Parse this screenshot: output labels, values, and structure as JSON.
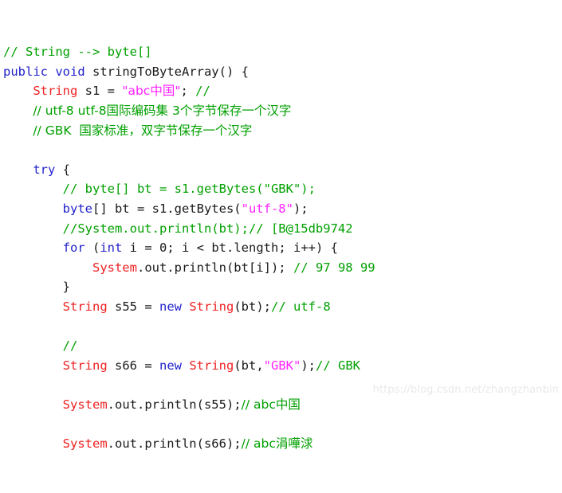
{
  "document": {
    "type": "source-code-screenshot",
    "language": "Java",
    "title": "stringToByteArray code snippet",
    "watermark": "https://blog.csdn.net/zhangzhanbin",
    "colors": {
      "background": "#ffffff",
      "comment": "#00a000",
      "keyword": "#2222cc",
      "class_name": "#ee2222",
      "string_literal": "#ff22ff",
      "plain_text": "#1a1a1a",
      "watermark": "#e9e9e9"
    }
  },
  "code": {
    "lines": [
      {
        "index": 1,
        "text": "// String --> byte[]",
        "tokens": [
          {
            "t": "// String --> byte[]",
            "k": "comment"
          }
        ]
      },
      {
        "index": 2,
        "text": "public void stringToByteArray() {",
        "tokens": [
          {
            "t": "public",
            "k": "keyword"
          },
          {
            "t": " ",
            "k": "plain"
          },
          {
            "t": "void",
            "k": "keyword"
          },
          {
            "t": " stringToByteArray() {",
            "k": "plain"
          }
        ]
      },
      {
        "index": 3,
        "text": "    String s1 = \"abc中国\"; //",
        "tokens": [
          {
            "t": "    ",
            "k": "plain"
          },
          {
            "t": "String",
            "k": "class"
          },
          {
            "t": " s1 = ",
            "k": "plain"
          },
          {
            "t": "\"abc中国\"",
            "k": "string"
          },
          {
            "t": "; ",
            "k": "plain"
          },
          {
            "t": "//",
            "k": "comment"
          }
        ]
      },
      {
        "index": 4,
        "text": "    // utf-8 utf-8国际编码集 3个字节保存一个汉字",
        "tokens": [
          {
            "t": "    ",
            "k": "plain"
          },
          {
            "t": "// utf-8 utf-8国际编码集 3个字节保存一个汉字",
            "k": "comment"
          }
        ]
      },
      {
        "index": 5,
        "text": "    // GBK  国家标准，双字节保存一个汉字",
        "tokens": [
          {
            "t": "    ",
            "k": "plain"
          },
          {
            "t": "// GBK  国家标准，双字节保存一个汉字",
            "k": "comment"
          }
        ]
      },
      {
        "index": 6,
        "text": "",
        "tokens": []
      },
      {
        "index": 7,
        "text": "    try {",
        "tokens": [
          {
            "t": "    ",
            "k": "plain"
          },
          {
            "t": "try",
            "k": "keyword"
          },
          {
            "t": " {",
            "k": "plain"
          }
        ]
      },
      {
        "index": 8,
        "text": "        // byte[] bt = s1.getBytes(\"GBK\");",
        "tokens": [
          {
            "t": "        ",
            "k": "plain"
          },
          {
            "t": "// byte[] bt = s1.getBytes(\"GBK\");",
            "k": "comment"
          }
        ]
      },
      {
        "index": 9,
        "text": "        byte[] bt = s1.getBytes(\"utf-8\");",
        "tokens": [
          {
            "t": "        ",
            "k": "plain"
          },
          {
            "t": "byte",
            "k": "keyword"
          },
          {
            "t": "[] bt = s1.getBytes(",
            "k": "plain"
          },
          {
            "t": "\"utf-8\"",
            "k": "string"
          },
          {
            "t": ");",
            "k": "plain"
          }
        ]
      },
      {
        "index": 10,
        "text": "        //System.out.println(bt);// [B@15db9742",
        "tokens": [
          {
            "t": "        ",
            "k": "plain"
          },
          {
            "t": "//System.out.println(bt);// [B@15db9742",
            "k": "comment"
          }
        ]
      },
      {
        "index": 11,
        "text": "        for (int i = 0; i < bt.length; i++) {",
        "tokens": [
          {
            "t": "        ",
            "k": "plain"
          },
          {
            "t": "for",
            "k": "keyword"
          },
          {
            "t": " (",
            "k": "plain"
          },
          {
            "t": "int",
            "k": "keyword"
          },
          {
            "t": " i = ",
            "k": "plain"
          },
          {
            "t": "0",
            "k": "number"
          },
          {
            "t": "; i < bt.length; i++) {",
            "k": "plain"
          }
        ]
      },
      {
        "index": 12,
        "text": "            System.out.println(bt[i]); // 97 98 99",
        "tokens": [
          {
            "t": "            ",
            "k": "plain"
          },
          {
            "t": "System",
            "k": "class"
          },
          {
            "t": ".out.println(bt[i]); ",
            "k": "plain"
          },
          {
            "t": "// 97 98 99",
            "k": "comment"
          }
        ]
      },
      {
        "index": 13,
        "text": "        }",
        "tokens": [
          {
            "t": "        }",
            "k": "plain"
          }
        ]
      },
      {
        "index": 14,
        "text": "        String s55 = new String(bt);// utf-8",
        "tokens": [
          {
            "t": "        ",
            "k": "plain"
          },
          {
            "t": "String",
            "k": "class"
          },
          {
            "t": " s55 = ",
            "k": "plain"
          },
          {
            "t": "new",
            "k": "keyword"
          },
          {
            "t": " ",
            "k": "plain"
          },
          {
            "t": "String",
            "k": "class"
          },
          {
            "t": "(bt);",
            "k": "plain"
          },
          {
            "t": "// utf-8",
            "k": "comment"
          }
        ]
      },
      {
        "index": 15,
        "text": "",
        "tokens": []
      },
      {
        "index": 16,
        "text": "        //",
        "tokens": [
          {
            "t": "        ",
            "k": "plain"
          },
          {
            "t": "//",
            "k": "comment"
          }
        ]
      },
      {
        "index": 17,
        "text": "        String s66 = new String(bt,\"GBK\");// GBK",
        "tokens": [
          {
            "t": "        ",
            "k": "plain"
          },
          {
            "t": "String",
            "k": "class"
          },
          {
            "t": " s66 = ",
            "k": "plain"
          },
          {
            "t": "new",
            "k": "keyword"
          },
          {
            "t": " ",
            "k": "plain"
          },
          {
            "t": "String",
            "k": "class"
          },
          {
            "t": "(bt,",
            "k": "plain"
          },
          {
            "t": "\"GBK\"",
            "k": "string"
          },
          {
            "t": ");",
            "k": "plain"
          },
          {
            "t": "// GBK",
            "k": "comment"
          }
        ]
      },
      {
        "index": 18,
        "text": "",
        "tokens": []
      },
      {
        "index": 19,
        "text": "        System.out.println(s55);// abc中国",
        "tokens": [
          {
            "t": "        ",
            "k": "plain"
          },
          {
            "t": "System",
            "k": "class"
          },
          {
            "t": ".out.println(s55);",
            "k": "plain"
          },
          {
            "t": "// abc中国",
            "k": "comment"
          }
        ]
      },
      {
        "index": 20,
        "text": "",
        "tokens": []
      },
      {
        "index": 21,
        "text": "        System.out.println(s66);// abc涓嘩浗",
        "tokens": [
          {
            "t": "        ",
            "k": "plain"
          },
          {
            "t": "System",
            "k": "class"
          },
          {
            "t": ".out.println(s66);",
            "k": "plain"
          },
          {
            "t": "// abc涓嘩浗",
            "k": "comment"
          }
        ]
      }
    ]
  }
}
